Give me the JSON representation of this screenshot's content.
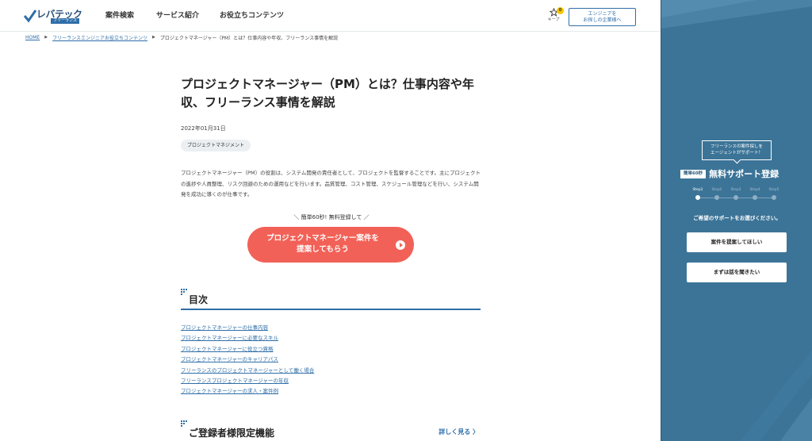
{
  "header": {
    "logo_text": "レバテック",
    "logo_sub": "フリーランス",
    "nav": [
      "案件検索",
      "サービス紹介",
      "お役立ちコンテンツ"
    ],
    "keep_label": "キープ",
    "keep_count": "0",
    "company_button": "エンジニアを\nお探しの企業様へ"
  },
  "breadcrumb": {
    "home": "HOME",
    "category": "フリーランスエンジニアお役立ちコンテンツ",
    "current": "プロジェクトマネージャー（PM）とは？仕事内容や年収、フリーランス事情を解説"
  },
  "article": {
    "title": "プロジェクトマネージャー（PM）とは？仕事内容や年収、フリーランス事情を解説",
    "date": "2022年01月31日",
    "tag": "プロジェクトマネジメント",
    "intro": "プロジェクトマネージャー（PM）の役割は、システム開発の責任者として、プロジェクトを監督することです。主にプロジェクトの進捗や人員整理、リスク回避のための運用などを行います。品質管理、コスト管理、スケジュール管理などを行い、システム開発を成功に導くのが仕事です。",
    "cta_caption": "＼ 簡単60秒! 無料登録して ／",
    "cta_button": "プロジェクトマネージャー案件を\n提案してもらう"
  },
  "toc": {
    "title": "目次",
    "items": [
      "プロジェクトマネージャーの仕事内容",
      "プロジェクトマネージャーに必要なスキル",
      "プロジェクトマネージャーに役立つ資格",
      "プロジェクトマネージャーのキャリアパス",
      "フリーランスのプロジェクトマネージャーとして働く場合",
      "フリーランスプロジェクトマネージャーの年収",
      "プロジェクトマネージャーの求人・案件例"
    ]
  },
  "registered": {
    "title": "ご登録者様限定機能",
    "more": "詳しく見る"
  },
  "side": {
    "bubble": "フリーランスの案件探しを\nエージェントがサポート！",
    "badge": "簡単60秒",
    "heading": "無料サポート登録",
    "steps": [
      "Step1",
      "Step2",
      "Step3",
      "Step4",
      "Step5"
    ],
    "prompt": "ご希望のサポートをお選びください。",
    "button1": "案件を提案してほしい",
    "button2": "まずは話を聞きたい"
  },
  "colors": {
    "brand_blue": "#2f6ea8",
    "cta_red": "#f26157",
    "side_bg": "#3c7497"
  }
}
